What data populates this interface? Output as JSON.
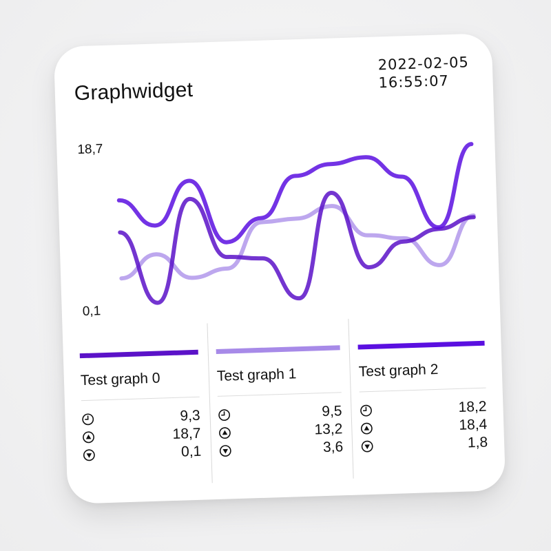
{
  "widget": {
    "title": "Graphwidget",
    "date": "2022-02-05",
    "time": "16:55:07"
  },
  "axis": {
    "max_label": "18,7",
    "min_label": "0,1"
  },
  "icons": {
    "current": "clock-icon",
    "max": "triangle-up-circle-icon",
    "min": "triangle-down-circle-icon"
  },
  "chart_data": {
    "type": "line",
    "ylim": [
      0.1,
      18.7
    ],
    "x": [
      0,
      1,
      2,
      3,
      4,
      5,
      6,
      7,
      8,
      9,
      10
    ],
    "series": [
      {
        "name": "Test graph 0",
        "color": "#5b12c8",
        "values": [
          8.8,
          0.1,
          12.6,
          5.4,
          5.1,
          0.1,
          12.8,
          3.6,
          6.6,
          8.0,
          9.3
        ]
      },
      {
        "name": "Test graph 1",
        "color": "#a78ae8",
        "values": [
          3.2,
          6.0,
          3.0,
          4.0,
          9.5,
          9.8,
          11.2,
          7.5,
          7.0,
          3.6,
          9.5
        ]
      },
      {
        "name": "Test graph 2",
        "color": "#5a0fe0",
        "values": [
          12.7,
          9.5,
          14.8,
          7.2,
          10.0,
          15.0,
          16.3,
          17.0,
          14.5,
          8.2,
          18.2
        ]
      }
    ]
  },
  "legend": [
    {
      "name": "Test graph 0",
      "color": "#5b12c8",
      "current": "9,3",
      "max": "18,7",
      "min": "0,1"
    },
    {
      "name": "Test graph 1",
      "color": "#a78ae8",
      "current": "9,5",
      "max": "13,2",
      "min": "3,6"
    },
    {
      "name": "Test graph 2",
      "color": "#5a0fe0",
      "current": "18,2",
      "max": "18,4",
      "min": "1,8"
    }
  ]
}
